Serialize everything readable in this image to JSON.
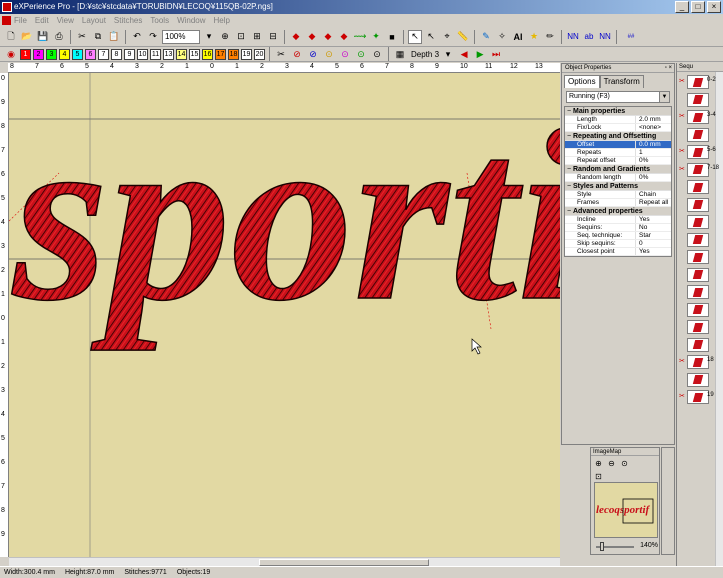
{
  "window": {
    "title": "eXPerience Pro - [D:¥stc¥stcdata¥TORUBIDN¥LECOQ¥115QB-02P.ngs]",
    "controls": [
      "_",
      "□",
      "×"
    ]
  },
  "menu": [
    "File",
    "Edit",
    "View",
    "Layout",
    "Stitches",
    "Tools",
    "Window",
    "Help"
  ],
  "toolbar": {
    "zoom": "100%",
    "depth_label": "Depth 3"
  },
  "palette": [
    {
      "n": "1",
      "c": "#ff0000"
    },
    {
      "n": "2",
      "c": "#ff00ff"
    },
    {
      "n": "3",
      "c": "#00ff00"
    },
    {
      "n": "4",
      "c": "#ffff00"
    },
    {
      "n": "5",
      "c": "#00ffff"
    },
    {
      "n": "6",
      "c": "#ff80ff"
    },
    {
      "n": "7",
      "c": "#ffffff"
    },
    {
      "n": "8",
      "c": "#ffffff"
    },
    {
      "n": "9",
      "c": "#ffffff"
    },
    {
      "n": "10",
      "c": "#ffffff"
    },
    {
      "n": "11",
      "c": "#ffffff"
    },
    {
      "n": "13",
      "c": "#ffffff"
    },
    {
      "n": "14",
      "c": "#ffff80"
    },
    {
      "n": "15",
      "c": "#ffffff"
    },
    {
      "n": "16",
      "c": "#ffff00"
    },
    {
      "n": "17",
      "c": "#ff8000"
    },
    {
      "n": "18",
      "c": "#ff8000"
    },
    {
      "n": "19",
      "c": "#ffffff"
    },
    {
      "n": "20",
      "c": "#ffffff"
    }
  ],
  "ruler": {
    "h": [
      "8",
      "7",
      "6",
      "5",
      "4",
      "3",
      "2",
      "1",
      "0",
      "1",
      "2",
      "3",
      "4",
      "5",
      "6",
      "7",
      "8",
      "9",
      "10",
      "11",
      "12",
      "13"
    ],
    "v": [
      "0",
      "9",
      "8",
      "7",
      "6",
      "5",
      "4",
      "3",
      "2",
      "1",
      "0",
      "1",
      "2",
      "3",
      "4",
      "5",
      "6",
      "7",
      "8",
      "9"
    ]
  },
  "canvas": {
    "text": "sportif"
  },
  "object_properties": {
    "title": "Object Properties",
    "tabs": [
      "Options",
      "Transform"
    ],
    "stitch_type": "Running (F3)",
    "groups": [
      {
        "label": "Main properties",
        "rows": [
          {
            "k": "Length",
            "v": "2.0 mm",
            "sel": false
          },
          {
            "k": "Fix/Lock",
            "v": "<none>",
            "sel": false
          }
        ]
      },
      {
        "label": "Repeating and Offsetting",
        "rows": [
          {
            "k": "Offset",
            "v": "0.0 mm",
            "sel": true
          },
          {
            "k": "Repeats",
            "v": "1",
            "sel": false
          },
          {
            "k": "Repeat offset",
            "v": "0%",
            "sel": false
          }
        ]
      },
      {
        "label": "Random and Gradients",
        "rows": [
          {
            "k": "Random length",
            "v": "0%",
            "sel": false
          }
        ]
      },
      {
        "label": "Styles and Patterns",
        "rows": [
          {
            "k": "Style",
            "v": "Chain",
            "sel": false
          },
          {
            "k": "Frames",
            "v": "Repeat all",
            "sel": false
          }
        ]
      },
      {
        "label": "Advanced properties",
        "rows": [
          {
            "k": "Incline",
            "v": "Yes",
            "sel": false
          },
          {
            "k": "Sequins:",
            "v": "No",
            "sel": false
          },
          {
            "k": "Seq. technique:",
            "v": "Star",
            "sel": false
          },
          {
            "k": "Skip sequins:",
            "v": "0",
            "sel": false
          },
          {
            "k": "Closest point",
            "v": "Yes",
            "sel": false
          }
        ]
      }
    ]
  },
  "sequence": {
    "title": "Sequ",
    "items": [
      "0-2",
      "",
      "3-4",
      "",
      "5-6",
      "7-18",
      "",
      "",
      "",
      "",
      "",
      "",
      "",
      "",
      "",
      "",
      "18",
      "",
      "19"
    ]
  },
  "imagemap": {
    "title": "ImageMap",
    "zoom": "140%",
    "thumb_text": "lecoqsportif"
  },
  "status": {
    "width": "Width:300.4 mm",
    "height": "Height:87.0 mm",
    "stitches": "Stitches:9771",
    "objects": "Objects:19"
  }
}
